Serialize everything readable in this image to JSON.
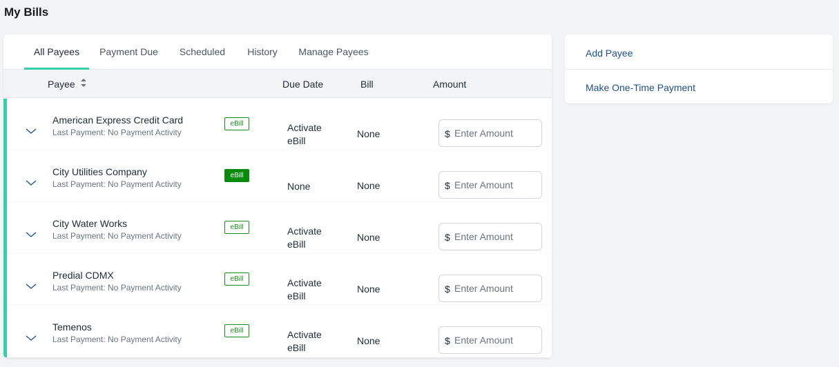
{
  "page": {
    "title": "My Bills"
  },
  "tabs": [
    {
      "label": "All Payees"
    },
    {
      "label": "Payment Due"
    },
    {
      "label": "Scheduled"
    },
    {
      "label": "History"
    },
    {
      "label": "Manage Payees"
    }
  ],
  "columns": {
    "payee": "Payee",
    "due_date": "Due Date",
    "bill": "Bill",
    "amount": "Amount"
  },
  "rows": [
    {
      "name": "American Express Credit Card",
      "last_payment": "Last Payment: No Payment Activity",
      "ebill": "eBill",
      "due": "Activate eBill",
      "bill": "None",
      "currency": "$",
      "amount_placeholder": "Enter Amount"
    },
    {
      "name": "City Utilities Company",
      "last_payment": "Last Payment: No Payment Activity",
      "ebill": "eBill",
      "due": "None",
      "bill": "None",
      "currency": "$",
      "amount_placeholder": "Enter Amount"
    },
    {
      "name": "City Water Works",
      "last_payment": "Last Payment: No Payment Activity",
      "ebill": "eBill",
      "due": "Activate eBill",
      "bill": "None",
      "currency": "$",
      "amount_placeholder": "Enter Amount"
    },
    {
      "name": "Predial CDMX",
      "last_payment": "Last Payment: No Payment Activity",
      "ebill": "eBill",
      "due": "Activate eBill",
      "bill": "None",
      "currency": "$",
      "amount_placeholder": "Enter Amount"
    },
    {
      "name": "Temenos",
      "last_payment": "Last Payment: No Payment Activity",
      "ebill": "eBill",
      "due": "Activate eBill",
      "bill": "None",
      "currency": "$",
      "amount_placeholder": "Enter Amount"
    }
  ],
  "side": {
    "add_payee": "Add Payee",
    "one_time": "Make One-Time Payment"
  },
  "colors": {
    "accent": "#34d0a8",
    "ebill_green": "#0a8a0a",
    "link_blue": "#1d4f91"
  }
}
